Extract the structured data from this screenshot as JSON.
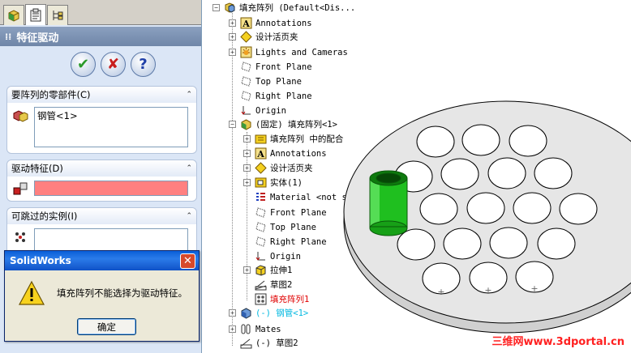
{
  "property_manager": {
    "title": "特征驱动",
    "tab_icons": [
      "part-icon",
      "property-manager-icon",
      "config-manager-icon"
    ],
    "buttons": {
      "ok": "✔",
      "cancel": "✘",
      "help": "?"
    },
    "groups": [
      {
        "title": "要阵列的零部件(C)",
        "field_value": "钢管<1>"
      },
      {
        "title": "驱动特征(D)",
        "field_value": ""
      },
      {
        "title": "可跳过的实例(I)",
        "field_value": ""
      }
    ]
  },
  "dialog": {
    "title": "SolidWorks",
    "close": "✕",
    "message": "填充阵列不能选择为驱动特征。",
    "ok_label": "确定"
  },
  "tree": {
    "root": "填充阵列  (Default<Dis...",
    "items": [
      {
        "label": "Annotations"
      },
      {
        "label": "设计活页夹"
      },
      {
        "label": "Lights and Cameras"
      },
      {
        "label": "Front Plane"
      },
      {
        "label": "Top Plane"
      },
      {
        "label": "Right Plane"
      },
      {
        "label": "Origin"
      },
      {
        "label": "(固定) 填充阵列<1>"
      },
      {
        "label": "填充阵列 中的配合"
      },
      {
        "label": "Annotations"
      },
      {
        "label": "设计活页夹"
      },
      {
        "label": "实体(1)"
      },
      {
        "label": "Material <not sp..."
      },
      {
        "label": "Front Plane"
      },
      {
        "label": "Top Plane"
      },
      {
        "label": "Right Plane"
      },
      {
        "label": "Origin"
      },
      {
        "label": "拉伸1"
      },
      {
        "label": "草图2"
      },
      {
        "label": "填充阵列1"
      },
      {
        "label": "(-) 钢管<1>"
      },
      {
        "label": "Mates"
      },
      {
        "label": "(-) 草图2"
      }
    ]
  },
  "viewport": {
    "watermark": "三维网www.3dportal.cn",
    "colors": {
      "plate": "#e6e6e6",
      "tube": "#1fbf1f",
      "edge": "#000000"
    }
  }
}
